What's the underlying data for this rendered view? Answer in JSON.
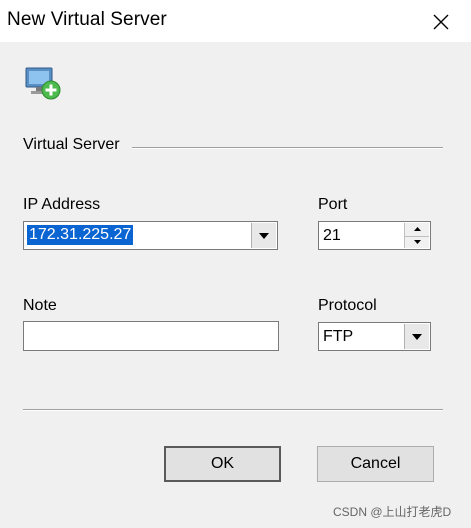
{
  "window": {
    "title": "New Virtual Server"
  },
  "icons": {
    "close": "close-icon",
    "dialog": "virtual-server-add-icon",
    "dropdown": "dropdown-arrow-icon"
  },
  "section": {
    "label": "Virtual Server"
  },
  "fields": {
    "ip_label": "IP Address",
    "ip_value": "172.31.225.27",
    "port_label": "Port",
    "port_value": "21",
    "note_label": "Note",
    "note_value": "",
    "protocol_label": "Protocol",
    "protocol_value": "FTP"
  },
  "buttons": {
    "ok": "OK",
    "cancel": "Cancel"
  },
  "watermark": "CSDN @上山打老虎D",
  "colors": {
    "selection": "#0a64d2",
    "titlebar": "#ffffff",
    "background": "#f0f0f0"
  }
}
